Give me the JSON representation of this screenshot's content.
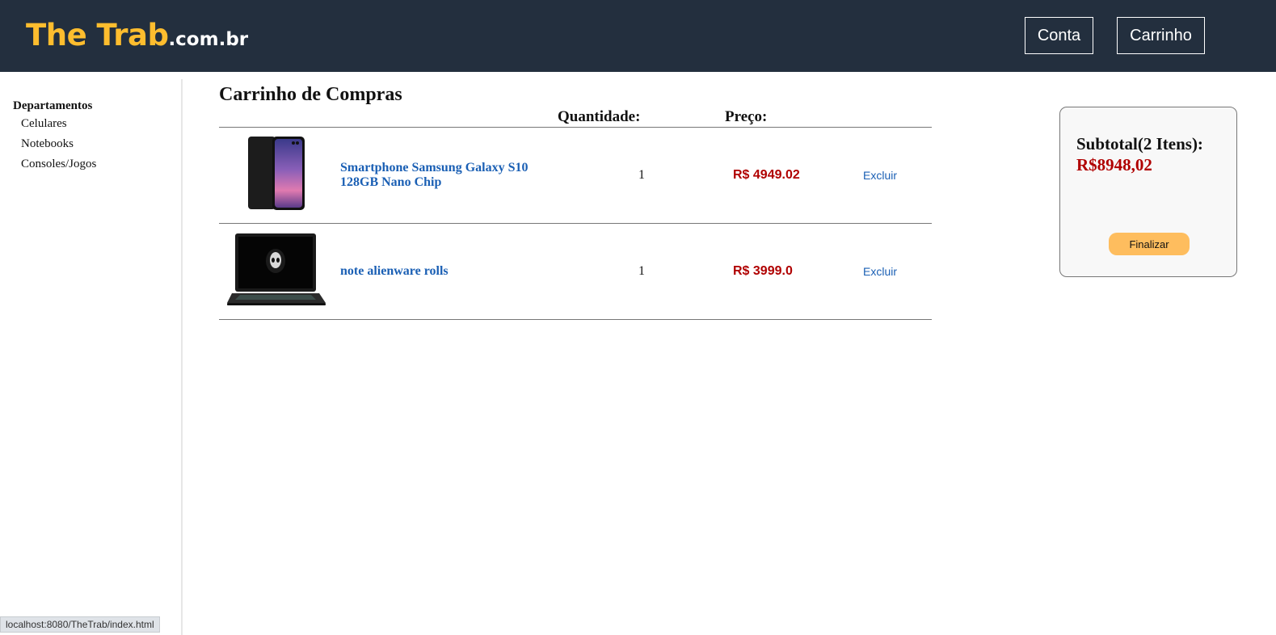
{
  "header": {
    "brand": "The Trab",
    "tld": ".com.br",
    "account_label": "Conta",
    "cart_label": "Carrinho"
  },
  "sidebar": {
    "title": "Departamentos",
    "items": [
      {
        "label": "Celulares"
      },
      {
        "label": "Notebooks"
      },
      {
        "label": "Consoles/Jogos"
      }
    ]
  },
  "cart": {
    "title": "Carrinho de Compras",
    "columns": {
      "quantity": "Quantidade:",
      "price": "Preço:"
    },
    "items": [
      {
        "name": "Smartphone Samsung Galaxy S10 128GB Nano Chip",
        "quantity": "1",
        "price": "R$ 4949.02",
        "remove_label": "Excluir",
        "image_icon": "smartphone-image"
      },
      {
        "name": "note alienware rolls",
        "quantity": "1",
        "price": "R$ 3999.0",
        "remove_label": "Excluir",
        "image_icon": "laptop-image"
      }
    ]
  },
  "summary": {
    "subtotal_label": "Subtotal(2 Itens):",
    "subtotal_value": "R$8948,02",
    "checkout_label": "Finalizar"
  },
  "status_url": "localhost:8080/TheTrab/index.html",
  "colors": {
    "header_bg": "#232f3e",
    "brand": "#febd2e",
    "price": "#b00000",
    "link": "#1a5fb4",
    "checkout_button": "#febd5e"
  }
}
